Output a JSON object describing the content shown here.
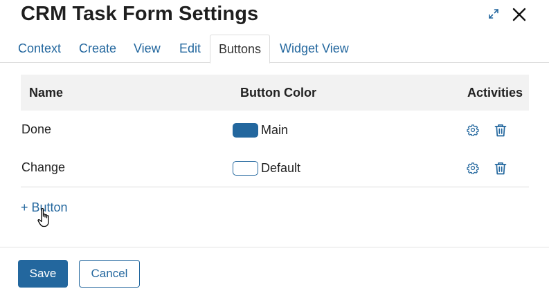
{
  "dialog": {
    "title": "CRM Task Form Settings"
  },
  "header_icons": {
    "expand": "expand-arrows-icon",
    "close": "close-x-icon"
  },
  "tabs": [
    {
      "label": "Context",
      "active": false
    },
    {
      "label": "Create",
      "active": false
    },
    {
      "label": "View",
      "active": false
    },
    {
      "label": "Edit",
      "active": false
    },
    {
      "label": "Buttons",
      "active": true
    },
    {
      "label": "Widget View",
      "active": false
    }
  ],
  "table": {
    "headers": {
      "name": "Name",
      "color": "Button Color",
      "activities": "Activities"
    },
    "rows": [
      {
        "name": "Done",
        "color_label": "Main",
        "swatch": "#23679e"
      },
      {
        "name": "Change",
        "color_label": "Default",
        "swatch": "#ffffff"
      }
    ],
    "row_icons": [
      "gear-icon",
      "trash-icon"
    ]
  },
  "add_button_label": "+ Button",
  "footer": {
    "save_label": "Save",
    "cancel_label": "Cancel"
  },
  "colors": {
    "accent": "#23679e",
    "header_bg": "#f2f2f2",
    "divider": "#dcdcdc"
  }
}
